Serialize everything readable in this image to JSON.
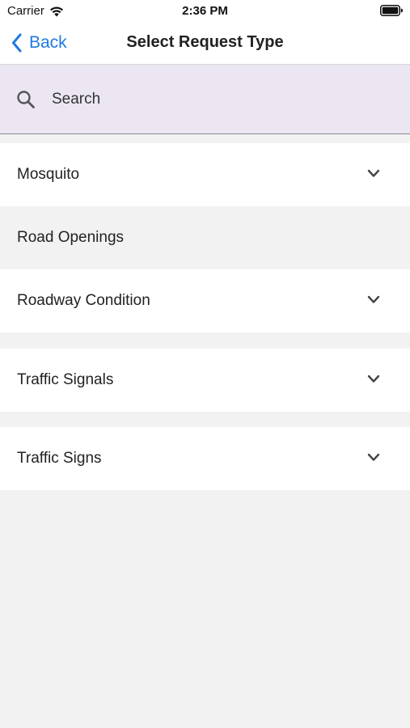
{
  "status_bar": {
    "carrier": "Carrier",
    "time": "2:36 PM",
    "icons": {
      "wifi": "wifi-icon",
      "battery": "battery-icon"
    }
  },
  "nav": {
    "back_label": "Back",
    "title": "Select Request Type"
  },
  "search": {
    "placeholder": "Search",
    "value": ""
  },
  "items": [
    {
      "label": "Mosquito",
      "expandable": true
    },
    {
      "label": "Road Openings",
      "expandable": false
    },
    {
      "label": "Roadway Condition",
      "expandable": true
    },
    {
      "label": "Traffic Signals",
      "expandable": true
    },
    {
      "label": "Traffic Signs",
      "expandable": true
    }
  ],
  "colors": {
    "accent": "#1f7ae0",
    "search_background": "#ece6f2",
    "page_background": "#f2f2f2",
    "row_background": "#ffffff"
  }
}
